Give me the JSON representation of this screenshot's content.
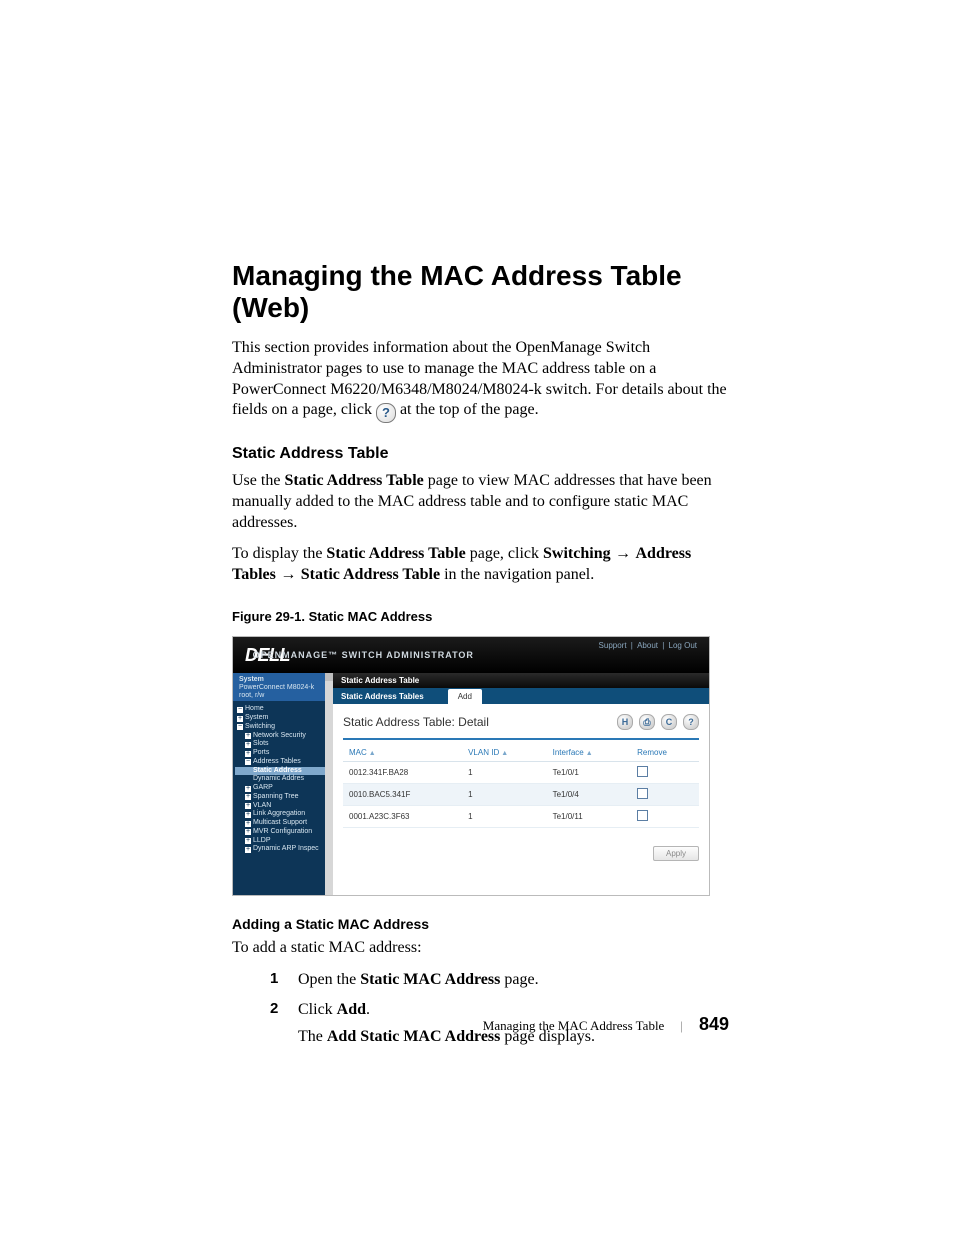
{
  "doc": {
    "h1": "Managing the MAC Address Table (Web)",
    "intro": "This section provides information about the OpenManage Switch Administrator pages to use to manage the MAC address table on a PowerConnect M6220/M6348/M8024/M8024-k switch. For details about the fields on a page, click ",
    "intro_tail": " at the top of the page.",
    "help_glyph": "?",
    "sub1": "Static Address Table",
    "p1a": "Use the ",
    "p1b": "Static Address Table",
    "p1c": " page to view MAC addresses that have been manually added to the MAC address table and to configure static MAC addresses.",
    "p2a": "To display the ",
    "p2b": "Static Address Table",
    "p2c": " page, click ",
    "p2d": "Switching",
    "p2arrow1": " → ",
    "p2e": "Address Tables",
    "p2arrow2": " → ",
    "p2f": "Static Address Table",
    "p2g": " in the navigation panel.",
    "figcap": "Figure 29-1.    Static MAC Address",
    "sub2": "Adding a Static MAC Address",
    "p3": "To add a static MAC address:",
    "steps": {
      "s1a": "Open the ",
      "s1b": "Static MAC Address",
      "s1c": " page.",
      "s2a": "Click ",
      "s2b": "Add",
      "s2c": ".",
      "s2follow_a": "The ",
      "s2follow_b": "Add Static MAC Address",
      "s2follow_c": " page displays."
    }
  },
  "mock": {
    "logo": "DELL",
    "app_title": "OPENMANAGE™ SWITCH ADMINISTRATOR",
    "links": {
      "support": "Support",
      "about": "About",
      "logout": "Log Out"
    },
    "side": {
      "header_l1": "System",
      "header_l2": "PowerConnect M8024-k",
      "header_l3": "root, r/w",
      "items": [
        {
          "lvl": 1,
          "icon": "minus",
          "label": "Home"
        },
        {
          "lvl": 1,
          "icon": "plus",
          "label": "System"
        },
        {
          "lvl": 1,
          "icon": "minus",
          "label": "Switching"
        },
        {
          "lvl": 2,
          "icon": "plus",
          "label": "Network Security"
        },
        {
          "lvl": 2,
          "icon": "plus",
          "label": "Slots"
        },
        {
          "lvl": 2,
          "icon": "plus",
          "label": "Ports"
        },
        {
          "lvl": 2,
          "icon": "minus",
          "label": "Address Tables"
        },
        {
          "lvl": 3,
          "icon": "",
          "label": "Static Address",
          "selected": true
        },
        {
          "lvl": 3,
          "icon": "",
          "label": "Dynamic Addres"
        },
        {
          "lvl": 2,
          "icon": "plus",
          "label": "GARP"
        },
        {
          "lvl": 2,
          "icon": "plus",
          "label": "Spanning Tree"
        },
        {
          "lvl": 2,
          "icon": "plus",
          "label": "VLAN"
        },
        {
          "lvl": 2,
          "icon": "plus",
          "label": "Link Aggregation"
        },
        {
          "lvl": 2,
          "icon": "plus",
          "label": "Multicast Support"
        },
        {
          "lvl": 2,
          "icon": "plus",
          "label": "MVR Configuration"
        },
        {
          "lvl": 2,
          "icon": "plus",
          "label": "LLDP"
        },
        {
          "lvl": 2,
          "icon": "plus",
          "label": "Dynamic ARP Inspec"
        }
      ]
    },
    "crumb": "Static Address Table",
    "tabs": {
      "left": "Static Address Tables",
      "right": "Add"
    },
    "detail_title": "Static Address Table: Detail",
    "cols": {
      "mac": "MAC",
      "vlan": "VLAN ID",
      "iface": "Interface",
      "remove": "Remove"
    },
    "rows": [
      {
        "mac": "0012.341F.BA28",
        "vlan": "1",
        "iface": "Te1/0/1"
      },
      {
        "mac": "0010.BAC5.341F",
        "vlan": "1",
        "iface": "Te1/0/4"
      },
      {
        "mac": "0001.A23C.3F63",
        "vlan": "1",
        "iface": "Te1/0/11"
      }
    ],
    "apply": "Apply",
    "icons": {
      "save": "H",
      "print": "⎙",
      "refresh": "C",
      "help": "?"
    }
  },
  "footer": {
    "text": "Managing the MAC Address Table",
    "page": "849"
  }
}
